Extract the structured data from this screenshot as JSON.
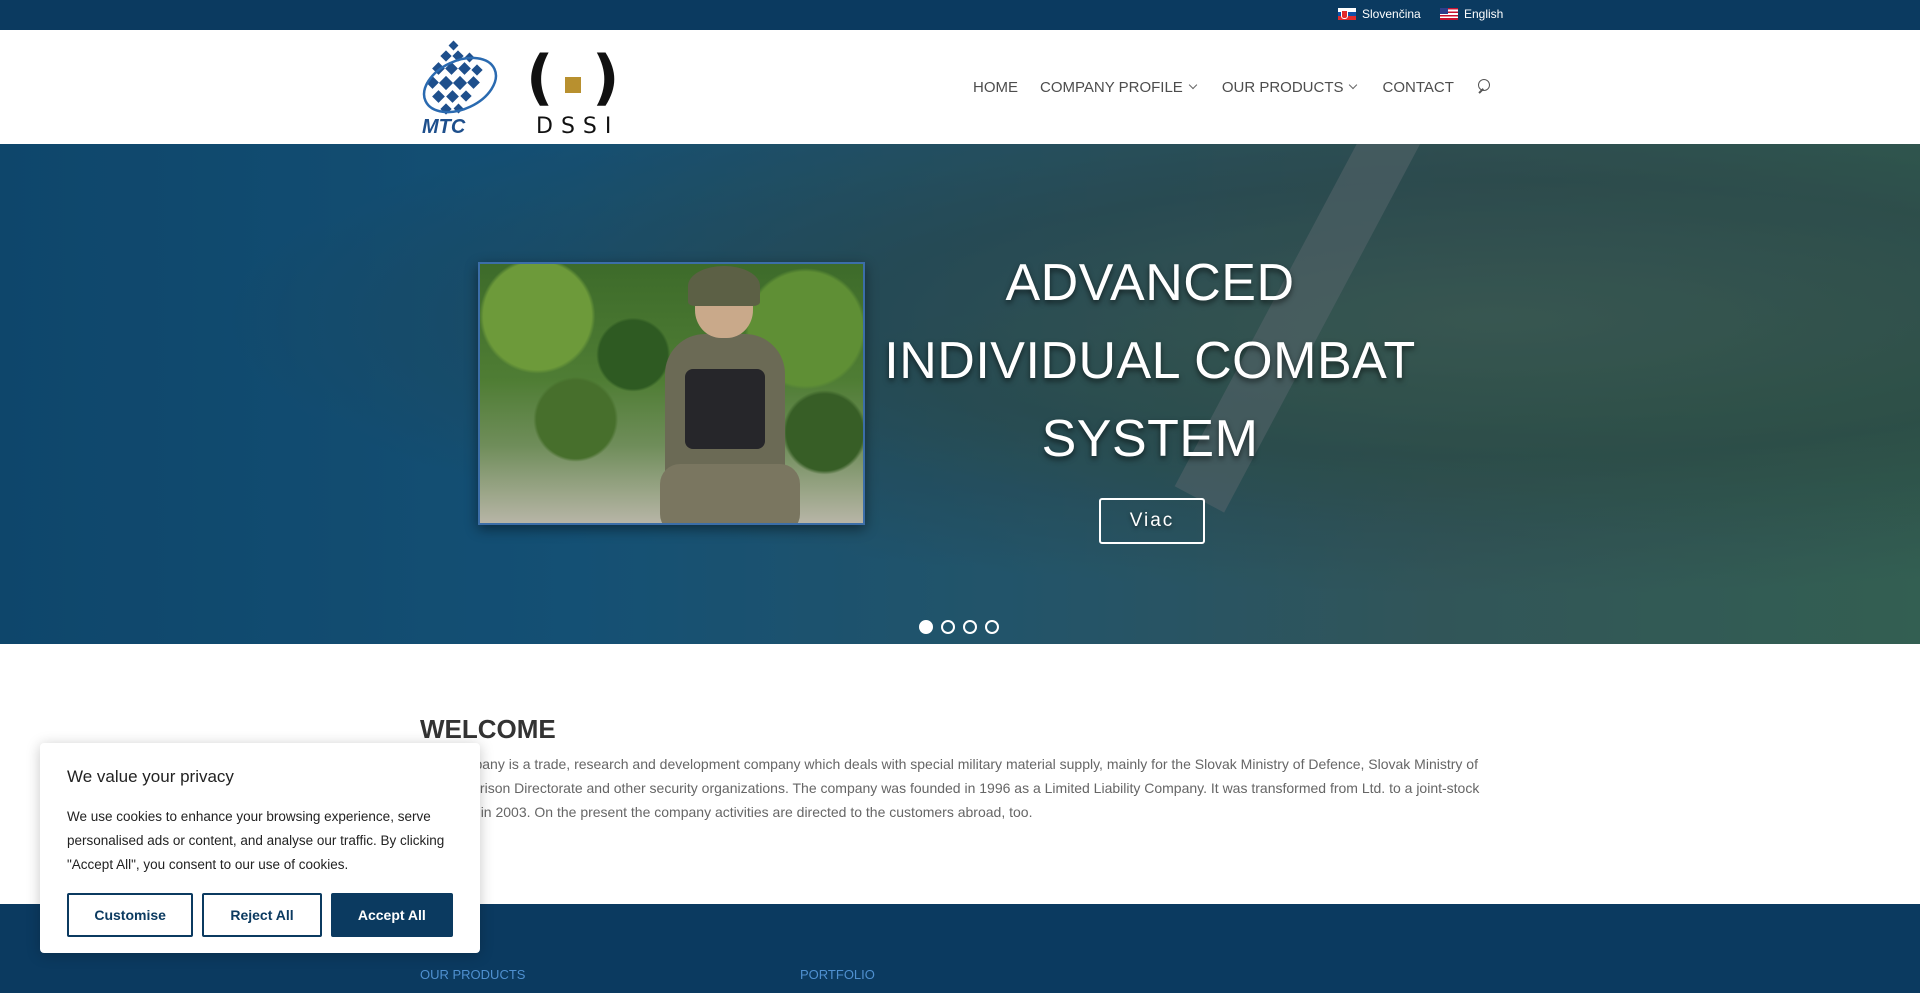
{
  "topbar": {
    "languages": [
      {
        "label": "Slovenčina",
        "flag": "slovak-flag-icon"
      },
      {
        "label": "English",
        "flag": "us-flag-icon"
      }
    ]
  },
  "header": {
    "logo_text_mtc": "MTC",
    "logo_text_dssi": "DSSI",
    "nav": [
      {
        "label": "HOME"
      },
      {
        "label": "COMPANY PROFILE"
      },
      {
        "label": "OUR PRODUCTS"
      },
      {
        "label": "CONTACT"
      }
    ]
  },
  "hero": {
    "title_lines": [
      "ADVANCED",
      "INDIVIDUAL COMBAT",
      "SYSTEM"
    ],
    "button_label": "Viac",
    "slide_count": 4,
    "active_slide": 1
  },
  "welcome": {
    "title": "WELCOME",
    "text": "The company is a trade, research and development company which deals with special military material supply, mainly for the Slovak Ministry of Defence, Slovak Ministry of Interior, Prison Directorate and other security organizations. The company was founded in 1996 as a Limited Liability Company. It was transformed from Ltd. to a joint-stock company in 2003. On the present the company activities are directed to the customers abroad, too."
  },
  "footer": {
    "links": [
      "OUR PRODUCTS",
      "PORTFOLIO"
    ]
  },
  "cookie": {
    "title": "We value your privacy",
    "text": "We use cookies to enhance your browsing experience, serve personalised ads or content, and analyse our traffic. By clicking \"Accept All\", you consent to our use of cookies.",
    "customise_label": "Customise",
    "reject_label": "Reject All",
    "accept_label": "Accept All"
  },
  "colors": {
    "brand_navy": "#0b3a60",
    "link_blue": "#4f90d0",
    "logo_gold": "#b8902f",
    "logo_blue": "#1e4f8c"
  }
}
